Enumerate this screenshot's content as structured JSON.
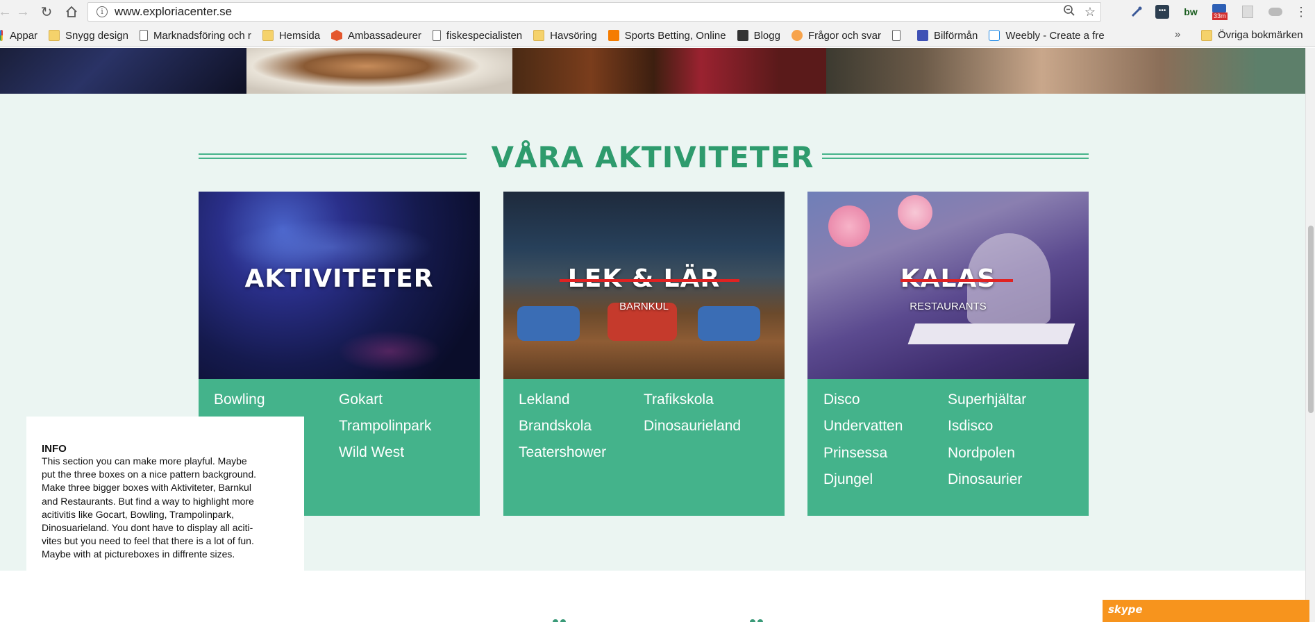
{
  "browser": {
    "url": "www.exploriacenter.se",
    "ext_badge": "33m",
    "ext_label_bw": "bw",
    "bookmarks": [
      {
        "label": "Appar",
        "icon": "apps-grid-icon"
      },
      {
        "label": "Snygg design",
        "icon": "folder-icon"
      },
      {
        "label": "Marknadsföring och r",
        "icon": "page-icon"
      },
      {
        "label": "Hemsida",
        "icon": "folder-icon"
      },
      {
        "label": "Ambassadeurer",
        "icon": "magento-icon"
      },
      {
        "label": "fiskespecialisten",
        "icon": "page-icon"
      },
      {
        "label": "Havsöring",
        "icon": "folder-icon"
      },
      {
        "label": "Sports Betting, Online",
        "icon": "betting-icon"
      },
      {
        "label": "Blogg",
        "icon": "x-icon"
      },
      {
        "label": "Frågor och svar",
        "icon": "chat-icon"
      },
      {
        "label": "",
        "icon": "page-icon"
      },
      {
        "label": "Bilförmån",
        "icon": "a-icon"
      },
      {
        "label": "Weebly - Create a fre",
        "icon": "weebly-icon"
      }
    ],
    "more_label": "»",
    "other_bookmarks": "Övriga bokmärken"
  },
  "section": {
    "title": "VÅRA AKTIVITETER"
  },
  "cards": [
    {
      "title": "AKTIVITETER",
      "subtitle": "",
      "col1": [
        "Bowling"
      ],
      "col2": [
        "Gokart",
        "Trampolinpark",
        "Wild West"
      ]
    },
    {
      "title": "LEK & LÄR",
      "subtitle": "BARNKUL",
      "col1": [
        "Lekland",
        "Brandskola",
        "Teatershower"
      ],
      "col2": [
        "Trafikskola",
        "Dinosaurieland"
      ]
    },
    {
      "title": "KALAS",
      "subtitle": "RESTAURANTS",
      "col1": [
        "Disco",
        "Undervatten",
        "Prinsessa",
        "Djungel"
      ],
      "col2": [
        "Superhjältar",
        "Isdisco",
        "Nordpolen",
        "Dinosaurier"
      ]
    }
  ],
  "info": {
    "title": "INFO",
    "lines": [
      "This section you can make more playful. Maybe",
      "put the three boxes on a nice pattern background.",
      "Make three bigger boxes with Aktiviteter, Barnkul",
      "and Restaurants. But find a way to highlight more",
      "acitivitis like Gocart, Bowling, Trampolinpark,",
      "Dinosuarieland. You dont have to display all aciti-",
      "vites but you need to feel that there is a lot of fun.",
      "Maybe with at pictureboxes in diffrente sizes."
    ]
  },
  "skype": {
    "label": "skype"
  },
  "colors": {
    "accent": "#2e9b6d",
    "card_list_bg": "#44b38b",
    "section_bg": "#ebf5f2",
    "strike": "#e02222",
    "skype_bar": "#f7941d"
  }
}
